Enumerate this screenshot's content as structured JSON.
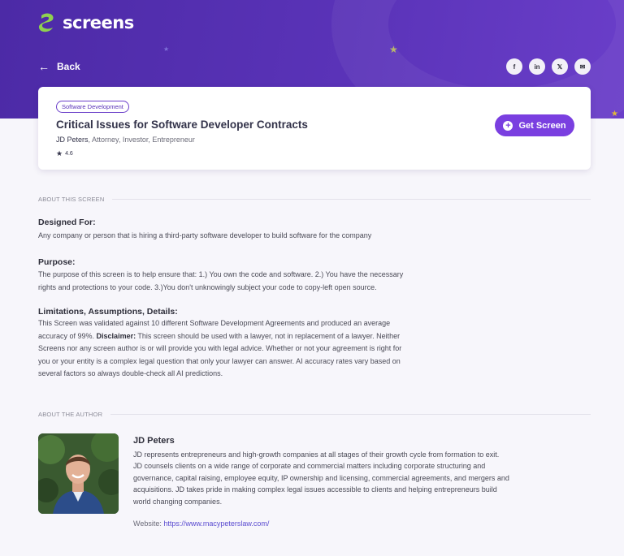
{
  "brand": {
    "name": "screens",
    "accent": "#7a3fe0",
    "hero_color": "#5a33b8"
  },
  "nav": {
    "back_label": "Back"
  },
  "social": [
    {
      "icon": "facebook-icon",
      "glyph": "f"
    },
    {
      "icon": "linkedin-icon",
      "glyph": "in"
    },
    {
      "icon": "x-icon",
      "glyph": "𝕏"
    },
    {
      "icon": "mail-icon",
      "glyph": "✉"
    }
  ],
  "screen": {
    "tag": "Software Development",
    "title": "Critical Issues for Software Developer Contracts",
    "author_name": "JD Peters",
    "author_roles": ", Attorney, Investor, Entrepreneur",
    "rating": "4.6",
    "cta_label": "Get Screen"
  },
  "about": {
    "heading": "ABOUT THIS SCREEN",
    "designed_for_label": "Designed For:",
    "designed_for_text": "Any company or person that is hiring a third-party software developer to build software for the company",
    "purpose_label": "Purpose:",
    "purpose_line1": "The purpose of this screen is to help ensure that: 1.) You own the code and software. 2.) You have the necessary",
    "purpose_line2": "rights and protections to your code. 3.)You don't unknowingly subject your code to copy-left open source.",
    "limits_label": "Limitations, Assumptions, Details:",
    "limits_line1": "This Screen was validated against 10 different Software Development Agreements and produced an average",
    "limits_line2_a": "accuracy of 99%. ",
    "limits_disclaimer": "Disclaimer:",
    "limits_line2_b": " This screen should be used with a lawyer, not in replacement of a lawyer. Neither",
    "limits_line3": "Screens nor any screen author is or will provide you with legal advice. Whether or not your agreement is right for",
    "limits_line4": "you or your entity is a complex legal question that only your lawyer can answer. AI accuracy rates vary based on",
    "limits_line5": "several factors so always double-check all AI predictions."
  },
  "author": {
    "heading": "ABOUT THE AUTHOR",
    "name": "JD Peters",
    "bio_1": "JD represents entrepreneurs and high-growth companies at all stages of their growth cycle from formation to exit.",
    "bio_2": "JD counsels clients on a wide range of corporate and commercial matters including corporate structuring and",
    "bio_3": "governance, capital raising, employee equity, IP ownership and licensing, commercial agreements, and mergers and",
    "bio_4": "acquisitions. JD takes pride in making complex legal issues accessible to clients and helping entrepreneurs build",
    "bio_5": "world changing companies.",
    "website_label": "Website: ",
    "website_url": "https://www.macypeterslaw.com/"
  }
}
